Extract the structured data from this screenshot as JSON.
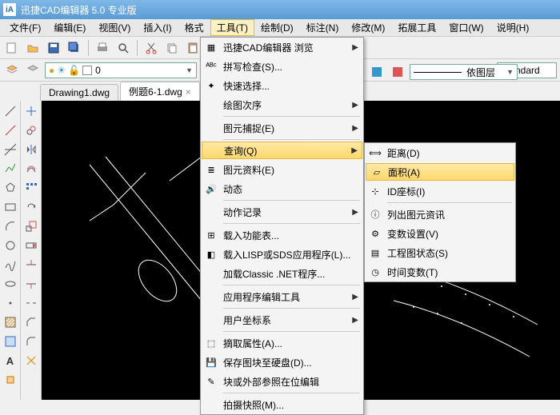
{
  "title": "迅捷CAD编辑器 5.0 专业版",
  "menubar": [
    "文件(F)",
    "编辑(E)",
    "视图(V)",
    "插入(I)",
    "格式",
    "工具(T)",
    "绘制(D)",
    "标注(N)",
    "修改(M)",
    "拓展工具",
    "窗口(W)",
    "说明(H)"
  ],
  "tabs": [
    {
      "label": "Drawing1.dwg",
      "active": false
    },
    {
      "label": "例题6-1.dwg",
      "active": true
    }
  ],
  "layer_combo": "0",
  "linetype_combo": "依图层",
  "style_combo": "Standard",
  "tools_menu": [
    {
      "label": "迅捷CAD编辑器 浏览",
      "arrow": true,
      "ico": "cad"
    },
    {
      "label": "拼写检查(S)...",
      "ico": "abc"
    },
    {
      "label": "快速选择...",
      "ico": "wand"
    },
    {
      "label": "绘图次序",
      "arrow": true
    },
    {
      "sep": true
    },
    {
      "label": "图元捕捉(E)",
      "arrow": true
    },
    {
      "sep": true
    },
    {
      "label": "查询(Q)",
      "arrow": true,
      "hl": true
    },
    {
      "label": "图元资料(E)",
      "ico": "list"
    },
    {
      "label": "动态",
      "ico": "sound"
    },
    {
      "sep": true
    },
    {
      "label": "动作记录",
      "arrow": true
    },
    {
      "sep": true
    },
    {
      "label": "载入功能表...",
      "ico": "grid"
    },
    {
      "label": "载入LISP或SDS应用程序(L)...",
      "ico": "app"
    },
    {
      "label": "加载Classic .NET程序..."
    },
    {
      "sep": true
    },
    {
      "label": "应用程序编辑工具",
      "arrow": true
    },
    {
      "sep": true
    },
    {
      "label": "用户坐标系",
      "arrow": true
    },
    {
      "sep": true
    },
    {
      "label": "摘取属性(A)...",
      "ico": "extract"
    },
    {
      "label": "保存图块至硬盘(D)...",
      "ico": "save"
    },
    {
      "label": "块或外部参照在位编辑",
      "ico": "edit"
    },
    {
      "sep": true
    },
    {
      "label": "拍摄快照(M)..."
    }
  ],
  "query_submenu": [
    {
      "label": "距离(D)",
      "ico": "dist"
    },
    {
      "label": "面积(A)",
      "hl": true,
      "ico": "area"
    },
    {
      "label": "ID座标(I)",
      "ico": "id"
    },
    {
      "sep": true
    },
    {
      "label": "列出图元资讯",
      "ico": "info"
    },
    {
      "label": "变数设置(V)",
      "ico": "var"
    },
    {
      "label": "工程图状态(S)",
      "ico": "status"
    },
    {
      "label": "时间变数(T)",
      "ico": "time"
    }
  ]
}
